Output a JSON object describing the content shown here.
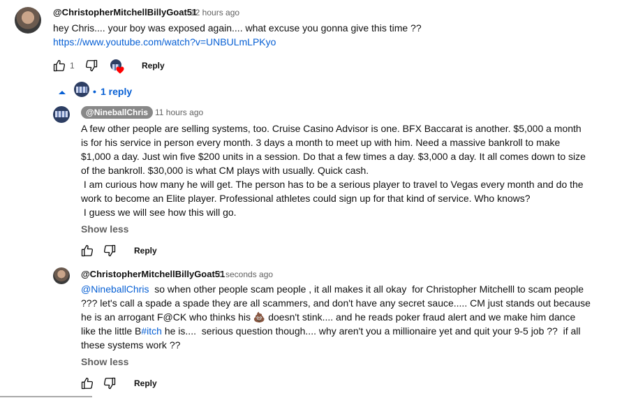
{
  "comment": {
    "author": "@ChristopherMitchellBillyGoat51",
    "time": "12 hours ago",
    "text": "hey Chris.... your boy was exposed again.... what excuse you gonna give this time ??",
    "link": "https://www.youtube.com/watch?v=UNBULmLPKyo",
    "like_count": "1",
    "reply_label": "Reply"
  },
  "replies_toggle": {
    "bullet": "•",
    "label": "1 reply"
  },
  "reply1": {
    "author": "@NineballChris",
    "time": "11 hours ago",
    "paragraphs": [
      "A few other people are selling systems, too. Cruise Casino Advisor is one. BFX Baccarat is another. $5,000 a month is for his service in person every month. 3 days a month to meet up with him. Need a massive bankroll to make $1,000 a day. Just win five $200 units in a session. Do that a few times a day. $3,000 a day. It all comes down to size of the bankroll. $30,000 is what CM plays with usually. Quick cash.",
      " I am curious how many he will get. The person has to be a serious player to travel to Vegas every month and do the work to become an Elite player. Professional athletes could sign up for that kind of service. Who knows?",
      " I guess we will see how this will go."
    ],
    "show_less": "Show less",
    "reply_label": "Reply"
  },
  "reply2": {
    "author": "@ChristopherMitchellBillyGoat51",
    "time": "0 seconds ago",
    "mention": "@NineballChris",
    "text_part1": "  so when other people scam people , it all makes it all okay  for Christopher Mitchelll to scam people ??? let's call a spade a spade they are all scammers, and don't have any secret sauce..... CM just stands out because he is an arrogant F@CK who thinks his ",
    "emoji": "💩",
    "text_part2": " doesn't stink.... and he reads poker fraud alert and we make him dance like the little B",
    "hashtag": "#itch",
    "text_part3": " he is....  serious question though.... why aren't you a millionaire yet and quit your 9-5 job ??  if all these systems work ??",
    "show_less": "Show less",
    "reply_label": "Reply"
  },
  "colors": {
    "link": "#065fd4",
    "heart": "#ff0000",
    "pill": "#888888",
    "secondary_text": "#606060"
  }
}
